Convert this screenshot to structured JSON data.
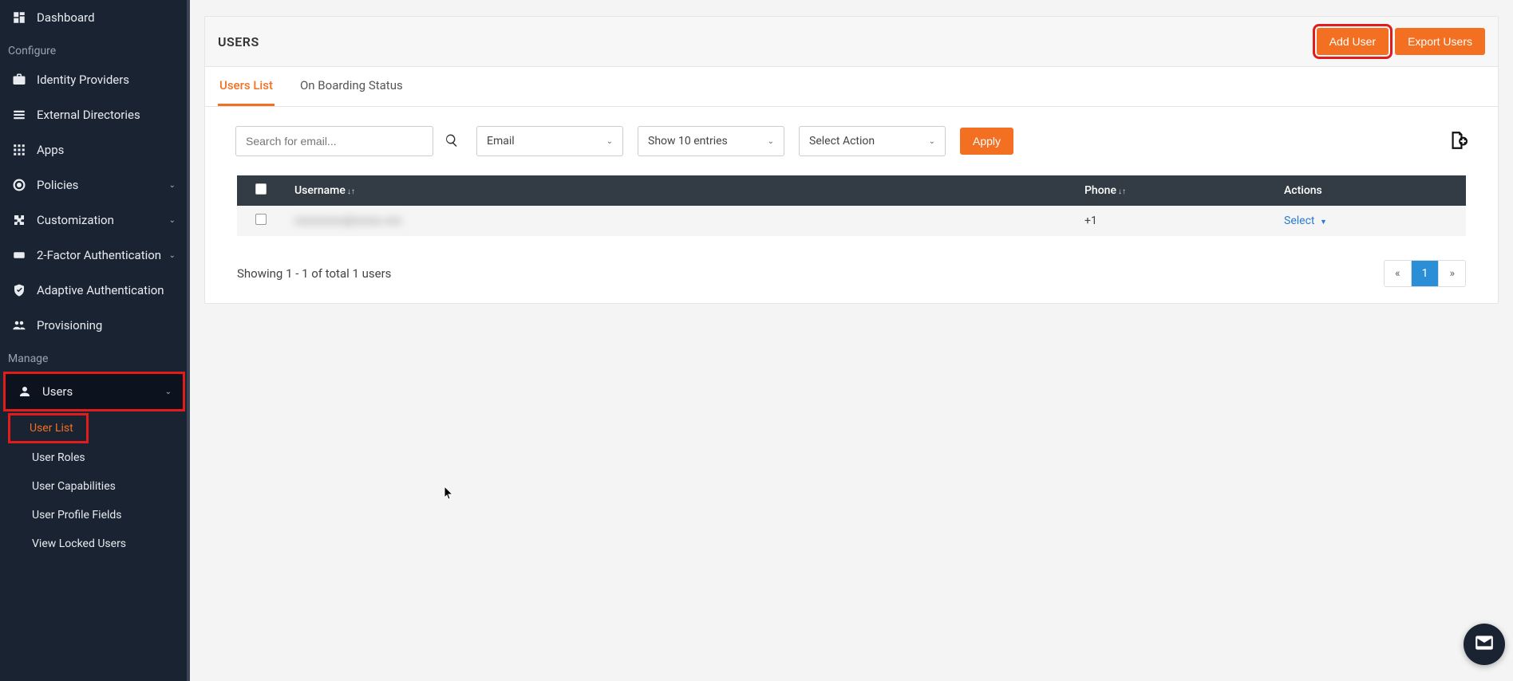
{
  "sidebar": {
    "items": {
      "dashboard": "Dashboard",
      "identity_providers": "Identity Providers",
      "external_directories": "External Directories",
      "apps": "Apps",
      "policies": "Policies",
      "customization": "Customization",
      "two_factor": "2-Factor Authentication",
      "adaptive_auth": "Adaptive Authentication",
      "provisioning": "Provisioning",
      "users": "Users"
    },
    "sections": {
      "configure": "Configure",
      "manage": "Manage"
    },
    "users_sub": {
      "user_list": "User List",
      "user_roles": "User Roles",
      "user_capabilities": "User Capabilities",
      "user_profile_fields": "User Profile Fields",
      "view_locked_users": "View Locked Users"
    }
  },
  "page": {
    "title": "USERS",
    "add_user": "Add User",
    "export_users": "Export Users"
  },
  "tabs": {
    "users_list": "Users List",
    "onboarding": "On Boarding Status"
  },
  "controls": {
    "search_placeholder": "Search for email...",
    "email_filter": "Email",
    "entries": "Show 10 entries",
    "action": "Select Action",
    "apply": "Apply"
  },
  "table": {
    "headers": {
      "username": "Username",
      "phone": "Phone",
      "actions": "Actions"
    },
    "rows": [
      {
        "username": "xxxxxxxxx@xxxxx.xxx",
        "phone": "+1",
        "action": "Select"
      }
    ],
    "footer": "Showing 1 - 1 of total 1 users",
    "pagination": {
      "prev": "«",
      "page1": "1",
      "next": "»"
    }
  }
}
